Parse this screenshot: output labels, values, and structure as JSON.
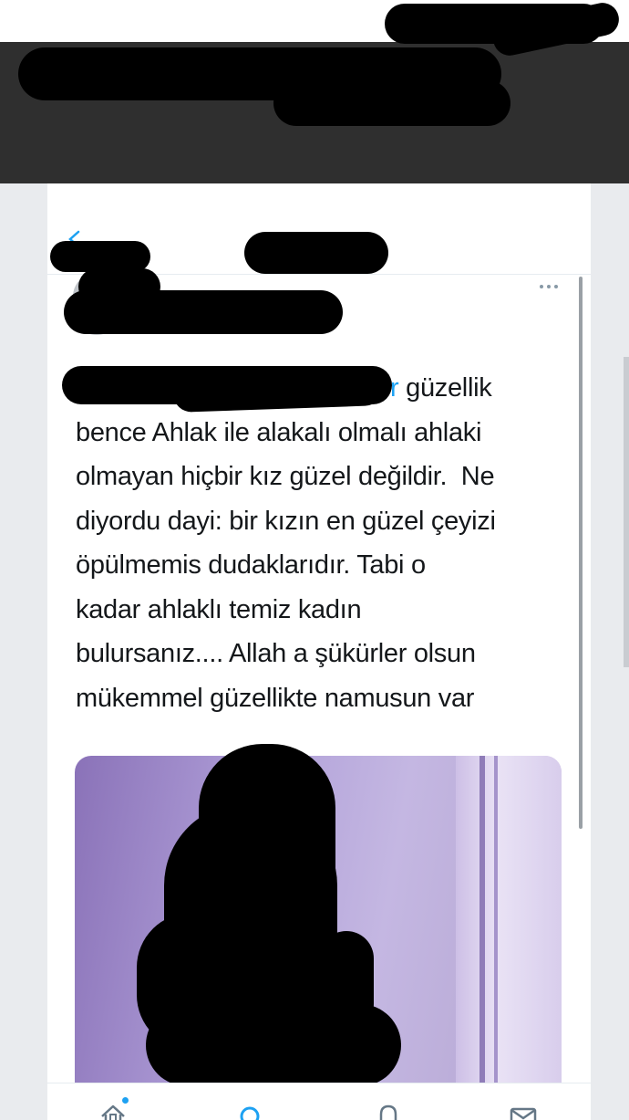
{
  "tweet": {
    "mention": "r",
    "lines": [
      " güzellik",
      "bence Ahlak ile alakalı olmalı ahlaki",
      "olmayan hiçbir kız güzel değildir.  Ne",
      "diyordu dayi: bir kızın en güzel çeyizi",
      "öpülmemis dudaklarıdır. Tabi o",
      "kadar ahlaklı temiz kadın",
      "bulursanız.... Allah a şükürler olsun",
      "mükemmel güzellikte namusun var"
    ]
  },
  "icons": {
    "back": "back-arrow-icon",
    "more": "more-options-icon",
    "nav": [
      "home-icon",
      "search-icon",
      "notifications-icon",
      "messages-icon"
    ]
  },
  "colors": {
    "accent": "#1da1f2",
    "header_band": "#2f2f2f",
    "text": "#14171a"
  }
}
